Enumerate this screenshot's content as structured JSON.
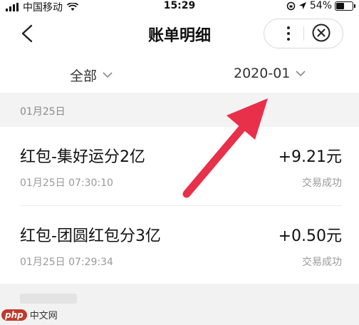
{
  "status_bar": {
    "carrier": "中国移动",
    "time": "15:29",
    "battery_percent": "54%",
    "battery_level": 0.54
  },
  "nav": {
    "title": "账单明细",
    "back_icon": "chevron-left-icon",
    "more_icon": "more-vertical-icon",
    "close_icon": "close-circle-icon"
  },
  "filters": {
    "category": "全部",
    "month": "2020-01"
  },
  "section": {
    "date": "01月25日"
  },
  "transactions": [
    {
      "title": "红包-集好运分2亿",
      "amount": "+9.21元",
      "time": "01月25日 07:30:10",
      "status": "交易成功"
    },
    {
      "title": "红包-团圆红包分3亿",
      "amount": "+0.50元",
      "time": "01月25日 07:29:34",
      "status": "交易成功"
    }
  ],
  "annotation": {
    "arrow_color": "#e8304a"
  },
  "watermark": {
    "logo": "php",
    "text": "中文网"
  }
}
